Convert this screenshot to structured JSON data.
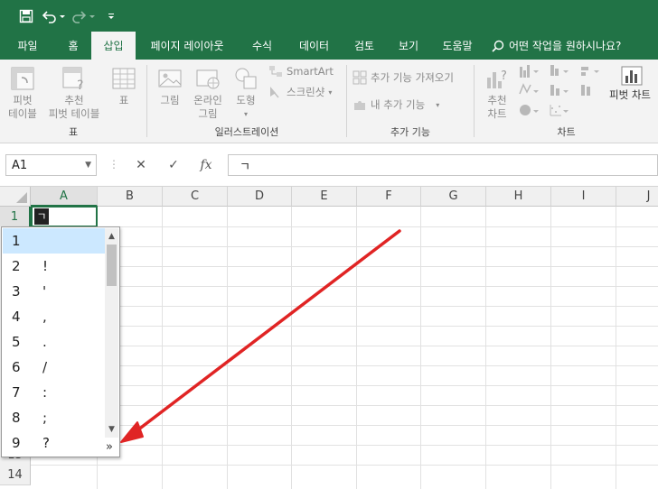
{
  "qat": {
    "save_icon": "save-icon",
    "undo_icon": "undo-icon",
    "redo_icon": "redo-icon",
    "customize_icon": "chevron-down-icon"
  },
  "tabs": [
    {
      "label": "파일"
    },
    {
      "label": "홈"
    },
    {
      "label": "삽입",
      "active": true
    },
    {
      "label": "페이지 레이아웃"
    },
    {
      "label": "수식"
    },
    {
      "label": "데이터"
    },
    {
      "label": "검토"
    },
    {
      "label": "보기"
    },
    {
      "label": "도움말"
    }
  ],
  "tell_me": "어떤 작업을 원하시나요?",
  "ribbon": {
    "tables": {
      "label": "표",
      "pivot_table": "피벗\n테이블",
      "recommended_pivot": "추천\n피벗 테이블",
      "table": "표"
    },
    "illustrations": {
      "label": "일러스트레이션",
      "picture": "그림",
      "online_picture": "온라인\n그림",
      "shapes": "도형",
      "smartart": "SmartArt",
      "screenshot": "스크린샷"
    },
    "addins": {
      "label": "추가 기능",
      "get_addins": "추가 기능 가져오기",
      "my_addins": "내 추가 기능"
    },
    "charts": {
      "label": "차트",
      "recommended_charts": "추천\n차트",
      "pivot_chart": "피벗 차트"
    }
  },
  "formula_bar": {
    "name_box": "A1",
    "cancel_icon": "✕",
    "enter_icon": "✓",
    "fx": "fx",
    "content": "ㄱ"
  },
  "columns": [
    "A",
    "B",
    "C",
    "D",
    "E",
    "F",
    "G",
    "H",
    "I",
    "J"
  ],
  "rows": [
    "1",
    "13",
    "14"
  ],
  "active_cell_text": "ㄱ",
  "ime_candidates": [
    {
      "num": "1",
      "char": ""
    },
    {
      "num": "2",
      "char": "!"
    },
    {
      "num": "3",
      "char": "'"
    },
    {
      "num": "4",
      "char": ","
    },
    {
      "num": "5",
      "char": "."
    },
    {
      "num": "6",
      "char": "/"
    },
    {
      "num": "7",
      "char": ":"
    },
    {
      "num": "8",
      "char": ";"
    },
    {
      "num": "9",
      "char": "?"
    }
  ],
  "ime_expand": "»",
  "colors": {
    "excel_green": "#217346",
    "annotation_arrow": "#e02424",
    "highlight": "#cce8ff"
  }
}
